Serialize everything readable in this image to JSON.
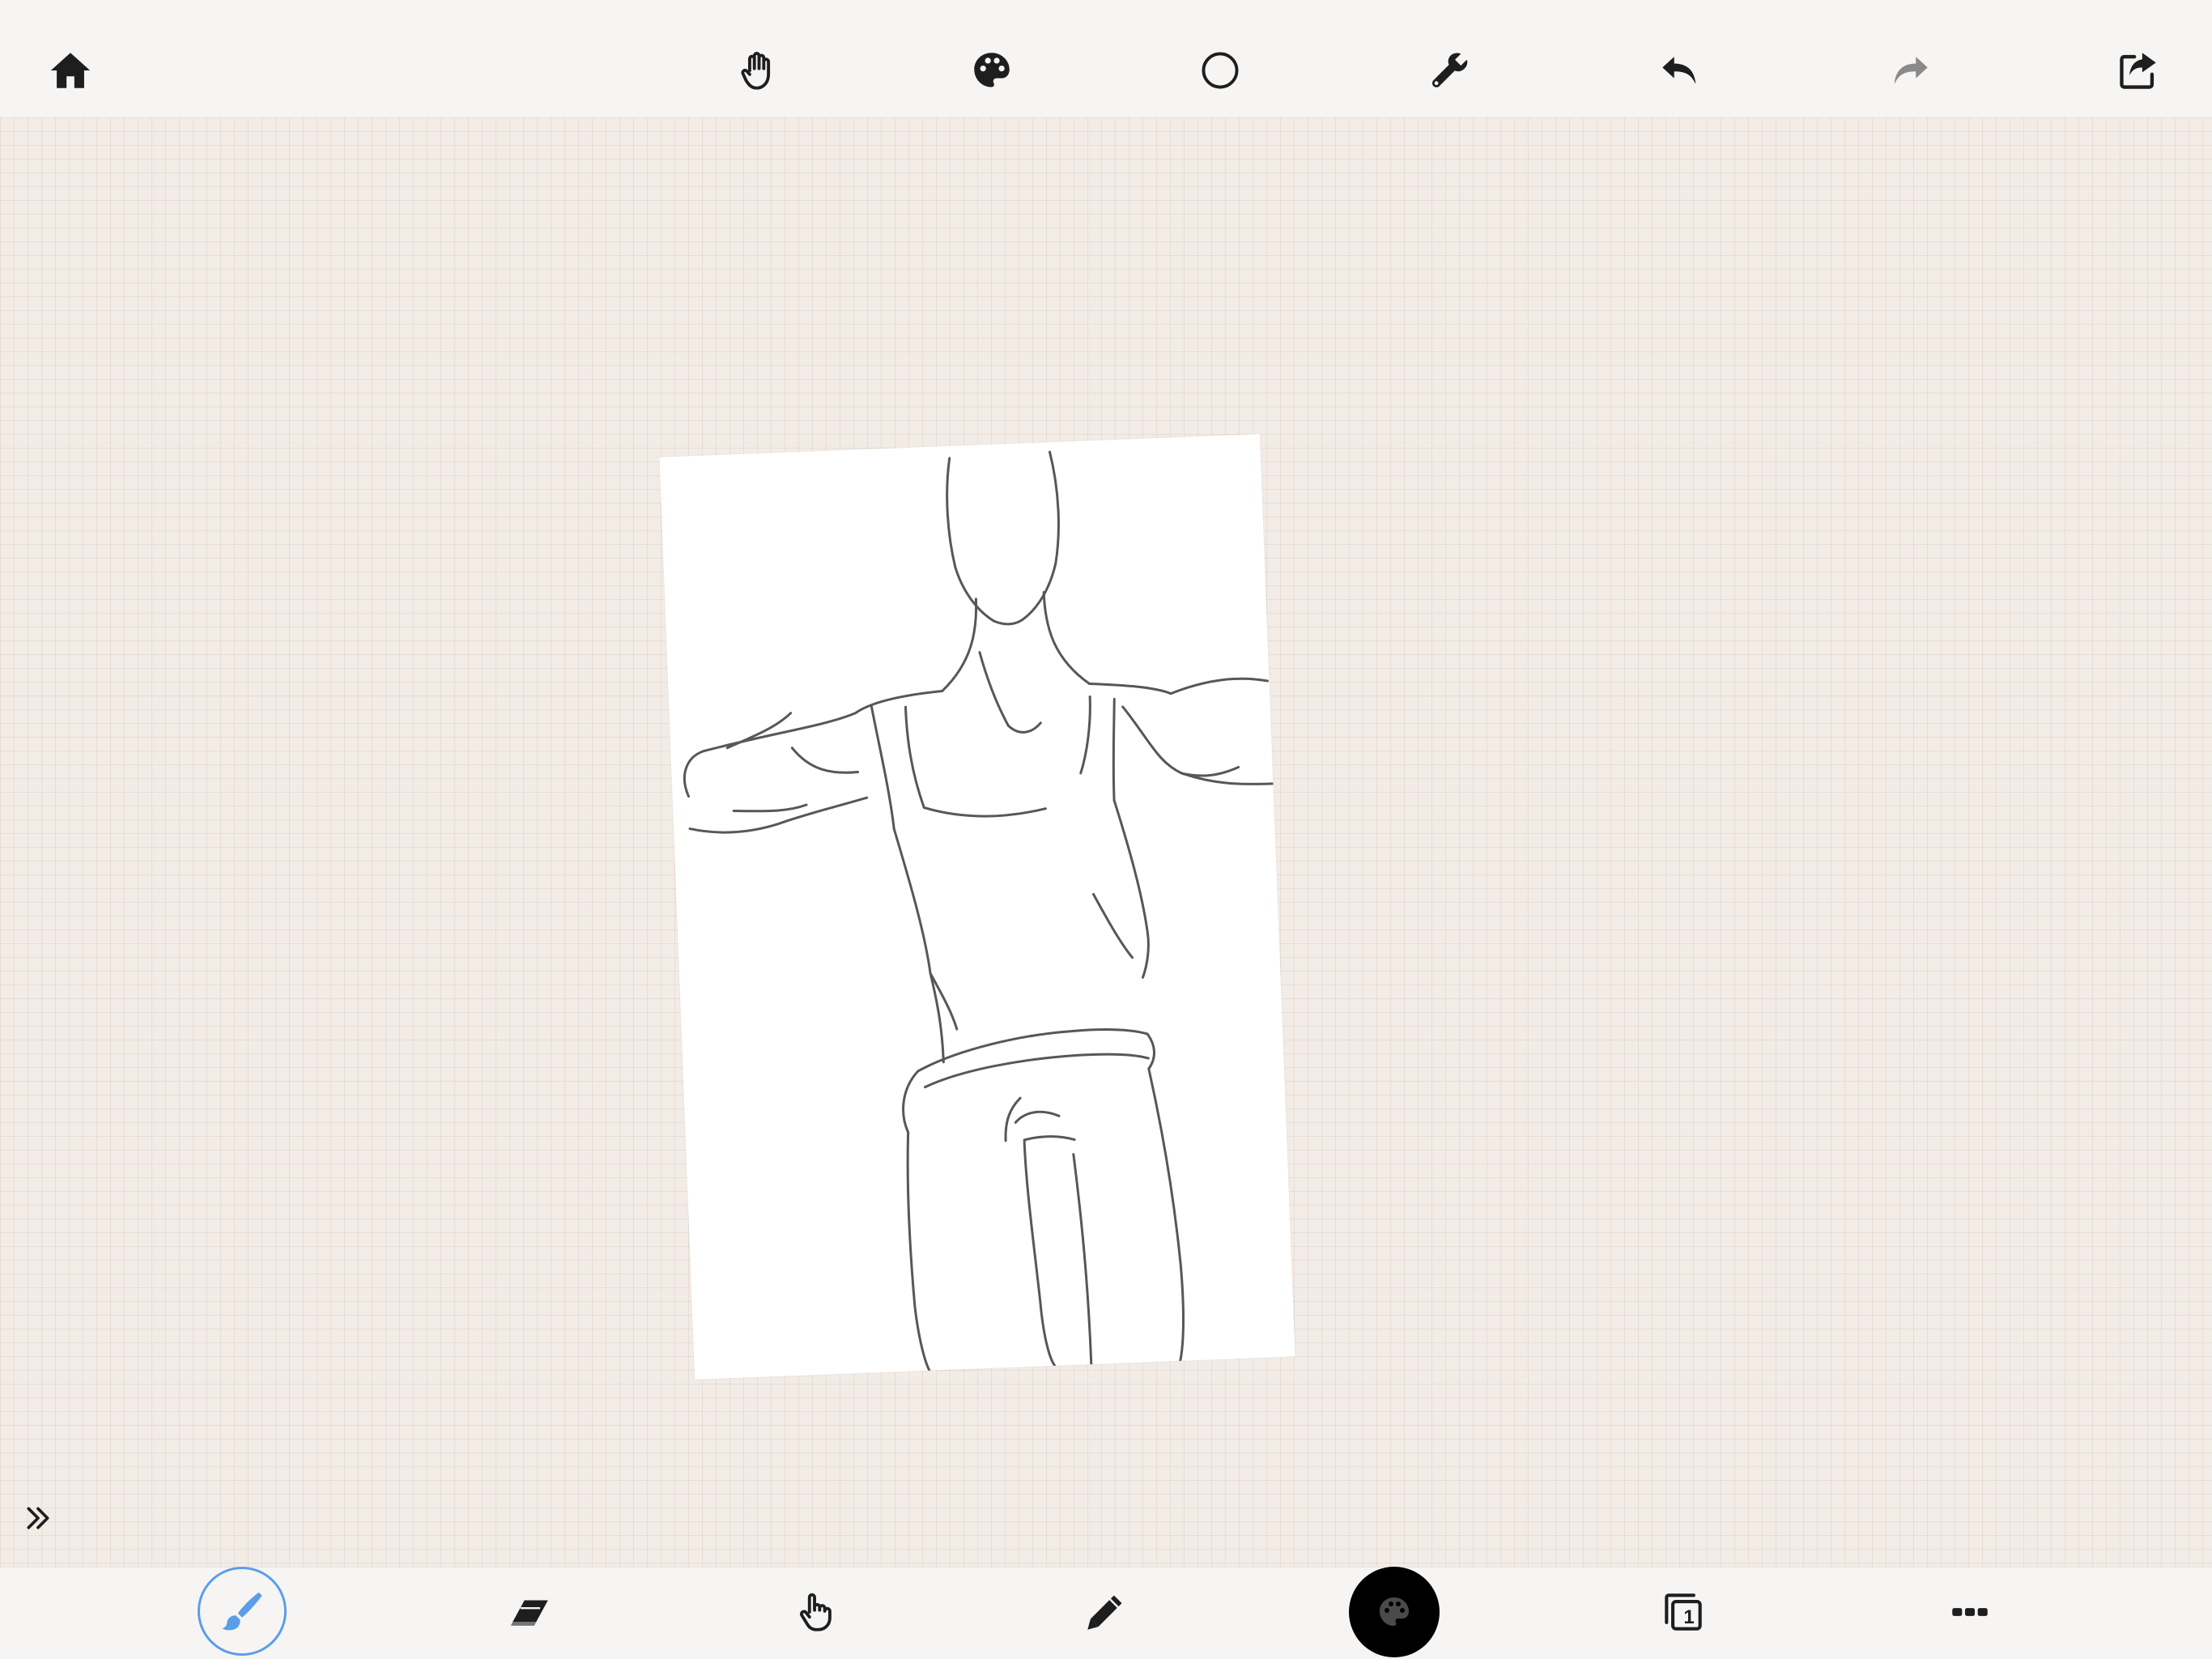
{
  "toolbar_top": {
    "items": [
      {
        "name": "home",
        "icon": "home-icon"
      },
      {
        "name": "pan",
        "icon": "hand-icon"
      },
      {
        "name": "palette",
        "icon": "palette-icon"
      },
      {
        "name": "shape",
        "icon": "circle-icon"
      },
      {
        "name": "settings",
        "icon": "wrench-icon"
      },
      {
        "name": "undo",
        "icon": "undo-icon"
      },
      {
        "name": "redo",
        "icon": "redo-icon",
        "disabled": true
      },
      {
        "name": "share",
        "icon": "share-icon"
      }
    ]
  },
  "toolbar_bottom": {
    "items": [
      {
        "name": "brush",
        "icon": "brush-icon",
        "active": true
      },
      {
        "name": "eraser",
        "icon": "eraser-icon"
      },
      {
        "name": "smudge",
        "icon": "finger-icon"
      },
      {
        "name": "pencil",
        "icon": "pencil-icon"
      },
      {
        "name": "color",
        "icon": "palette-icon",
        "color": "#000000"
      },
      {
        "name": "layers",
        "icon": "layers-icon"
      },
      {
        "name": "more",
        "icon": "more-dots-icon"
      }
    ],
    "layer_count": "1"
  },
  "colors": {
    "active_tool": "#5b9ee8",
    "icon": "#1e1e1e",
    "disabled_icon": "#8a8a8a",
    "current_color": "#000000",
    "canvas_bg": "#f3ece6"
  }
}
